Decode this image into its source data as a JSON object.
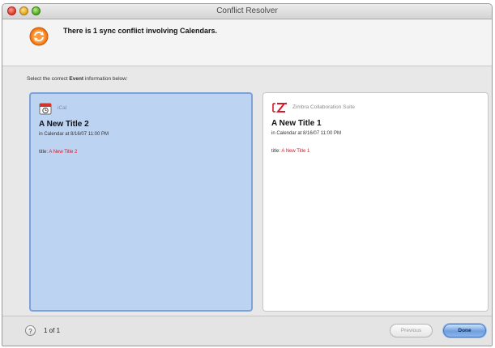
{
  "window": {
    "title": "Conflict Resolver"
  },
  "header": {
    "message": "There is 1 sync conflict involving Calendars."
  },
  "prompt": {
    "before": "Select the correct ",
    "bold": "Event",
    "after": " information below:"
  },
  "panes": [
    {
      "source": "iCal",
      "icon": "ical-calendar-icon",
      "selected": true,
      "title": "A New Title 2",
      "subtitle": "in Calendar at 8/16/07 11:00 PM",
      "field_label": "title:",
      "field_value": "A New Title 2"
    },
    {
      "source": "Zimbra Collaboration Suite",
      "icon": "zimbra-logo-icon",
      "selected": false,
      "title": "A New Title 1",
      "subtitle": "in Calendar at 8/16/07 11:00 PM",
      "field_label": "title:",
      "field_value": "A New Title 1"
    }
  ],
  "footer": {
    "help_glyph": "?",
    "page_indicator": "1 of 1",
    "previous_label": "Previous",
    "done_label": "Done"
  },
  "colors": {
    "selected_pane": "#bdd3f2",
    "selected_border": "#7da2da",
    "field_value": "#d41a2a",
    "sync_icon": "#f07a1a"
  }
}
